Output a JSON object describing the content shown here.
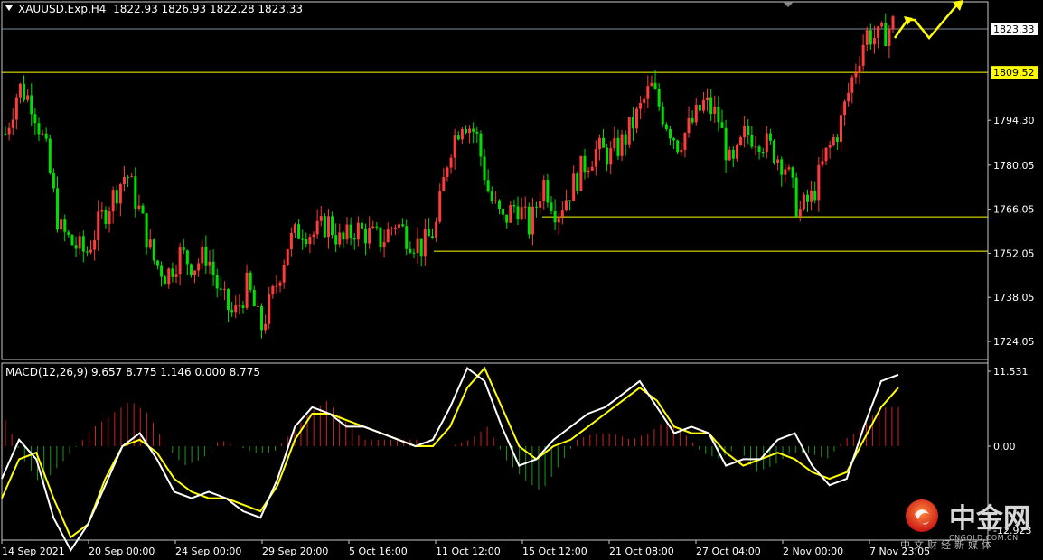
{
  "header": {
    "symbol": "XAUUSD.Exp,H4",
    "ohlc": "1822.93 1826.93 1822.28 1823.33"
  },
  "macd_header": "MACD(12,26,9) 9.657 8.775 1.146 0.000 8.775",
  "colors": {
    "bull": "#ff3b3b",
    "bear": "#00e000",
    "level": "#ffff00",
    "macd": "#ffffff",
    "signal": "#ffff00",
    "price_line": "#7f8c9e"
  },
  "chart_data": [
    {
      "type": "candlestick",
      "symbol": "XAUUSD.Exp",
      "timeframe": "H4",
      "y_ticks": [
        "1823.33",
        "1809.52",
        "1794.30",
        "1780.05",
        "1766.05",
        "1752.05",
        "1738.05",
        "1724.05"
      ],
      "y_tick_values": [
        1823.33,
        1809.52,
        1794.3,
        1780.05,
        1766.05,
        1752.05,
        1738.05,
        1724.05
      ],
      "current_price": "1823.33",
      "horizontal_levels": [
        {
          "value": 1809.52,
          "label": "1809.52"
        },
        {
          "value": 1763.6
        },
        {
          "value": 1752.7
        }
      ],
      "x_labels": [
        "14 Sep 2021",
        "20 Sep 00:00",
        "24 Sep 00:00",
        "29 Sep 20:00",
        "5 Oct 16:00",
        "11 Oct 12:00",
        "15 Oct 12:00",
        "21 Oct 08:00",
        "27 Oct 04:00",
        "2 Nov 00:00",
        "7 Nov 23:05"
      ],
      "close_path": [
        1790,
        1805,
        1800,
        1785,
        1760,
        1755,
        1752,
        1762,
        1770,
        1778,
        1765,
        1750,
        1745,
        1752,
        1748,
        1752,
        1738,
        1732,
        1742,
        1728,
        1740,
        1755,
        1760,
        1758,
        1762,
        1755,
        1760,
        1758,
        1756,
        1762,
        1757,
        1754,
        1760,
        1785,
        1795,
        1790,
        1770,
        1762,
        1768,
        1760,
        1775,
        1765,
        1772,
        1780,
        1785,
        1783,
        1788,
        1796,
        1805,
        1795,
        1787,
        1793,
        1800,
        1795,
        1778,
        1790,
        1789,
        1785,
        1780,
        1765,
        1770,
        1783,
        1792,
        1808,
        1822,
        1820,
        1825
      ]
    },
    {
      "type": "macd",
      "params": "MACD(12,26,9)",
      "y_ticks": [
        "11.531",
        "0.00",
        "-12.923"
      ],
      "y_tick_values": [
        11.531,
        0,
        -12.923
      ],
      "macd": [
        -5,
        1,
        -2,
        -11,
        -16,
        -12,
        -6,
        0,
        2,
        -2,
        -7,
        -8,
        -7,
        -8,
        -10,
        -11,
        -5,
        3,
        6,
        5,
        3,
        3,
        2,
        1,
        0,
        1,
        6,
        12,
        10,
        3,
        -3,
        -2,
        1,
        3,
        5,
        6,
        8,
        10,
        6,
        2,
        3,
        2,
        -3,
        -2,
        -2,
        1,
        2,
        -3,
        -6,
        -5,
        3,
        10,
        11
      ],
      "signal": [
        -8,
        -2,
        -1,
        -8,
        -14,
        -12,
        -5,
        0,
        1,
        -1,
        -5,
        -7,
        -8,
        -8,
        -9,
        -10,
        -6,
        1,
        5,
        5,
        4,
        3,
        2,
        1,
        0,
        0,
        3,
        9,
        12,
        6,
        0,
        -2,
        0,
        1,
        3,
        5,
        7,
        9,
        7,
        3,
        2,
        2,
        -1,
        -3,
        -2,
        -1,
        -2,
        -4,
        -5,
        -4,
        1,
        6,
        9
      ],
      "histogram": [
        4,
        -2,
        -6,
        -3,
        0,
        3,
        5,
        7,
        5,
        0,
        -3,
        -2,
        1,
        0,
        -1,
        -1,
        2,
        5,
        7,
        4,
        1,
        1,
        1,
        1,
        0,
        0,
        1,
        3,
        -2,
        -5,
        -7,
        -3,
        1,
        2,
        2,
        1,
        2,
        4,
        2,
        -1,
        -2,
        0,
        -4,
        -3,
        -1,
        -1,
        -2,
        1,
        3,
        6,
        6
      ]
    }
  ],
  "watermark": {
    "cn": "中金网",
    "en": "CNGOLD.COM.CN",
    "sub": "中文财经新媒体"
  }
}
